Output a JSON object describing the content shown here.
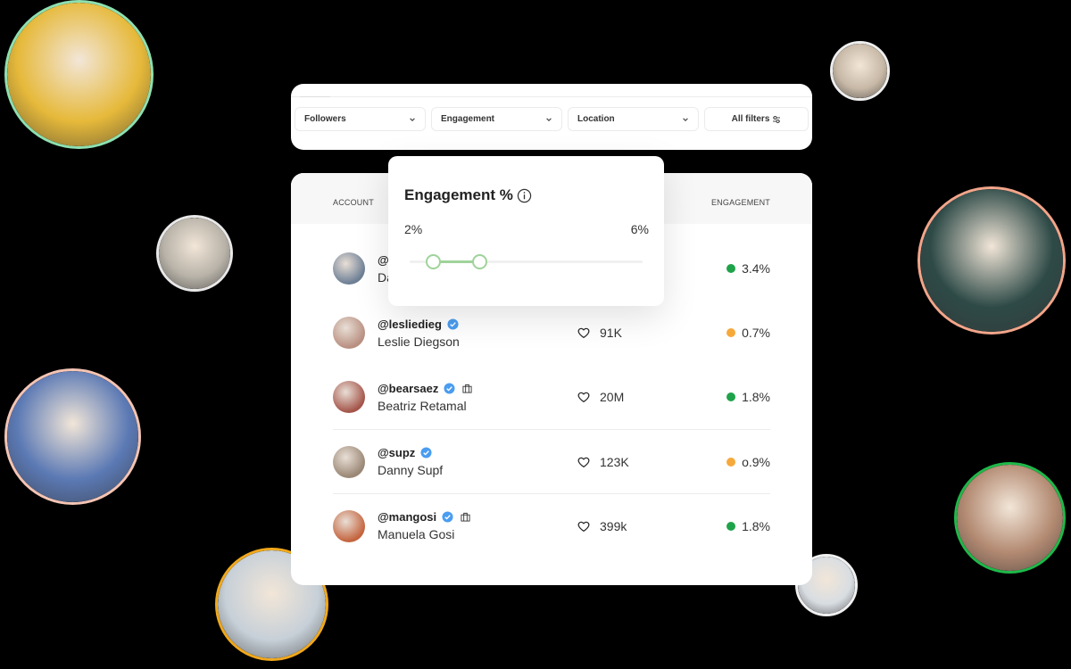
{
  "filters": {
    "items": [
      {
        "label": "Followers"
      },
      {
        "label": "Engagement"
      },
      {
        "label": "Location"
      }
    ],
    "all_filters_label": "All filters"
  },
  "table": {
    "headers": {
      "account": "ACCOUNT",
      "engagement": "ENGAGEMENT"
    },
    "rows": [
      {
        "handle": "@",
        "name": "Da",
        "verified": false,
        "business": false,
        "followers": "",
        "engagement": "3.4%",
        "status": "good",
        "avatar_color": "#6d7f95"
      },
      {
        "handle": "@lesliedieg",
        "name": "Leslie Diegson",
        "verified": true,
        "business": false,
        "followers": "91K",
        "engagement": "0.7%",
        "status": "low",
        "avatar_color": "#b88f80"
      },
      {
        "handle": "@bearsaez",
        "name": "Beatriz Retamal",
        "verified": true,
        "business": true,
        "followers": "20M",
        "engagement": "1.8%",
        "status": "good",
        "avatar_color": "#a4554a"
      },
      {
        "handle": "@supz",
        "name": "Danny Supf",
        "verified": true,
        "business": false,
        "followers": "123K",
        "engagement": "o.9%",
        "status": "low",
        "avatar_color": "#9a8775"
      },
      {
        "handle": "@mangosi",
        "name": "Manuela Gosi",
        "verified": true,
        "business": true,
        "followers": "399k",
        "engagement": "1.8%",
        "status": "good",
        "avatar_color": "#c4643e"
      }
    ]
  },
  "popover": {
    "title": "Engagement %",
    "min_label": "2%",
    "max_label": "6%",
    "range_low_fraction": 0.1,
    "range_high_fraction": 0.3
  },
  "colors": {
    "good": "#1fa34a",
    "low": "#f6a93b",
    "verified": "#4a9df0",
    "slider": "#9fd39a"
  },
  "floating_avatars": [
    {
      "id": "top-left",
      "ring": "#8ee0b0",
      "fill": "#e6b93a"
    },
    {
      "id": "mid-left",
      "ring": "#e8e8e8",
      "fill": "#b8b2a8"
    },
    {
      "id": "left",
      "ring": "#f4c4b4",
      "fill": "#5b79b4"
    },
    {
      "id": "bottom-left",
      "ring": "#f0a81c",
      "fill": "#c7d0d8"
    },
    {
      "id": "top-right-small",
      "ring": "#eeeeee",
      "fill": "#c7b8a6"
    },
    {
      "id": "right",
      "ring": "#f2a58a",
      "fill": "#2e4a47"
    },
    {
      "id": "bottom-right",
      "ring": "#1fb84a",
      "fill": "#b38a72"
    },
    {
      "id": "bottom-center-small",
      "ring": "#f0f0f0",
      "fill": "#d8dde2"
    }
  ]
}
